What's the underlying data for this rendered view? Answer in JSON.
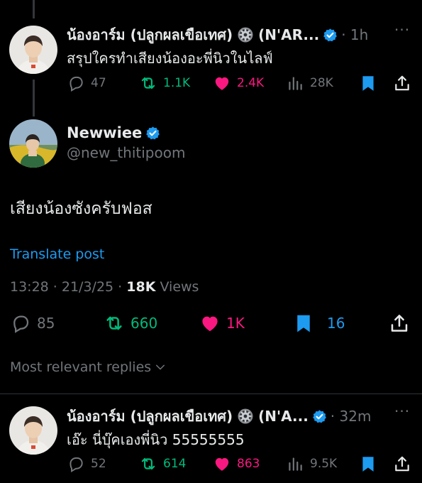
{
  "tweet_top": {
    "name": "น้องอาร์ม (ปลูกผลเขือเทศ)",
    "name_suffix": "(N'AR...",
    "time": "1h",
    "text": "สรุปใครทำเสียงน้องอะพี่นิวในไลฟ์",
    "replies": "47",
    "reposts": "1.1K",
    "likes": "2.4K",
    "views": "28K"
  },
  "main_tweet": {
    "name": "Newwiee",
    "handle": "@new_thitipoom",
    "text": "เสียงน้องซังครับฟอส",
    "translate": "Translate post",
    "timestamp": "13:28 · 21/3/25 · ",
    "views_count": "18K",
    "views_label": " Views",
    "replies": "85",
    "reposts": "660",
    "likes": "1K",
    "bookmarks": "16"
  },
  "sort_label": "Most relevant replies",
  "reply_tweet": {
    "name": "น้องอาร์ม (ปลูกผลเขือเทศ)",
    "name_suffix": "(N'A...",
    "time": "32m",
    "text": "เอ๊ะ นี่บุ๊คเองพี่นิว 55555555",
    "replies": "52",
    "reposts": "614",
    "likes": "863",
    "views": "9.5K"
  },
  "colors": {
    "background": "#000000",
    "text": "#e7e9ea",
    "muted": "#71767b",
    "repost": "#00ba7c",
    "like": "#f91880",
    "accent": "#1d9bf0"
  }
}
